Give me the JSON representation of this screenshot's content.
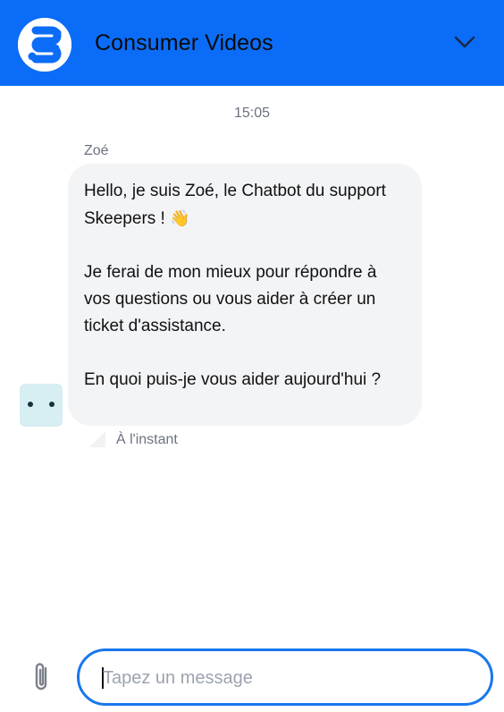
{
  "header": {
    "title": "Consumer Videos",
    "logo_icon": "skeepers-logo-icon",
    "collapse_icon": "chevron-down-icon",
    "background_color": "#0b6df7"
  },
  "conversation": {
    "timestamp": "15:05",
    "messages": [
      {
        "sender": "Zoé",
        "paragraphs": [
          "Hello, je suis Zoé, le Chatbot du support Skeepers ! ",
          "Je ferai de mon mieux pour répondre à vos questions ou vous aider à créer un ticket d'assistance.",
          "En quoi puis-je vous aider aujourd'hui ?"
        ],
        "emoji": "👋",
        "status": "À l'instant",
        "avatar_icon": "bot-avatar-icon"
      }
    ]
  },
  "composer": {
    "placeholder": "Tapez un message",
    "value": "",
    "attach_icon": "paperclip-icon",
    "accent_color": "#1877ee"
  }
}
